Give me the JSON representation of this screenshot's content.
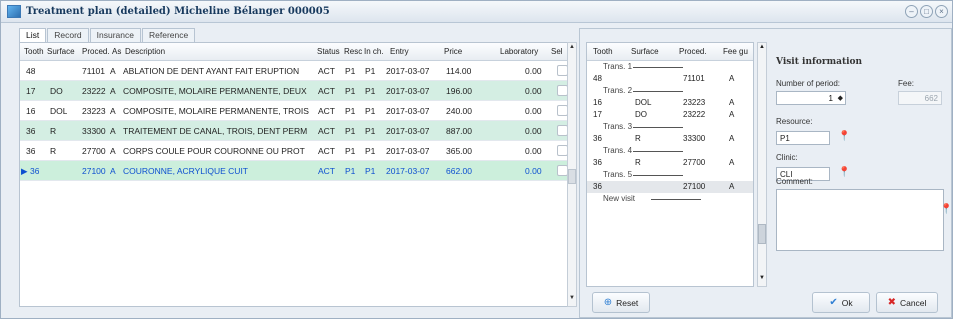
{
  "window": {
    "title": "Treatment plan (detailed) Micheline Bélanger 000005"
  },
  "tabs": [
    "List",
    "Record",
    "Insurance",
    "Reference"
  ],
  "grid": {
    "columns": [
      "Tooth",
      "Surface",
      "Proced.",
      "As",
      "Description",
      "Status",
      "Resc",
      "In ch.",
      "Entry",
      "Price",
      "Laboratory",
      "Sel"
    ],
    "rows": [
      {
        "tooth": "48",
        "surface": "",
        "proced": "71101",
        "as": "A",
        "description": "ABLATION DE DENT AYANT FAIT ERUPTION",
        "status": "ACT",
        "resc": "P1",
        "inch": "P1",
        "entry": "2017-03-07",
        "price": "114.00",
        "lab": "0.00"
      },
      {
        "tooth": "17",
        "surface": "DO",
        "proced": "23222",
        "as": "A",
        "description": "COMPOSITE, MOLAIRE PERMANENTE, DEUX",
        "status": "ACT",
        "resc": "P1",
        "inch": "P1",
        "entry": "2017-03-07",
        "price": "196.00",
        "lab": "0.00"
      },
      {
        "tooth": "16",
        "surface": "DOL",
        "proced": "23223",
        "as": "A",
        "description": "COMPOSITE, MOLAIRE PERMANENTE, TROIS",
        "status": "ACT",
        "resc": "P1",
        "inch": "P1",
        "entry": "2017-03-07",
        "price": "240.00",
        "lab": "0.00"
      },
      {
        "tooth": "36",
        "surface": "R",
        "proced": "33300",
        "as": "A",
        "description": "TRAITEMENT DE CANAL, TROIS, DENT PERM",
        "status": "ACT",
        "resc": "P1",
        "inch": "P1",
        "entry": "2017-03-07",
        "price": "887.00",
        "lab": "0.00"
      },
      {
        "tooth": "36",
        "surface": "R",
        "proced": "27700",
        "as": "A",
        "description": "CORPS COULE POUR COURONNE OU PROT",
        "status": "ACT",
        "resc": "P1",
        "inch": "P1",
        "entry": "2017-03-07",
        "price": "365.00",
        "lab": "0.00"
      },
      {
        "tooth": "36",
        "surface": "",
        "proced": "27100",
        "as": "A",
        "description": "COURONNE, ACRYLIQUE CUIT",
        "status": "ACT",
        "resc": "P1",
        "inch": "P1",
        "entry": "2017-03-07",
        "price": "662.00",
        "lab": "0.00"
      }
    ]
  },
  "trans_list": {
    "columns": [
      "Tooth",
      "Surface",
      "Proced.",
      "Fee gu"
    ],
    "groups": [
      {
        "label": "Trans. 1",
        "rows": [
          {
            "tooth": "48",
            "surface": "",
            "proced": "71101",
            "as": "A"
          }
        ]
      },
      {
        "label": "Trans. 2",
        "rows": [
          {
            "tooth": "16",
            "surface": "DOL",
            "proced": "23223",
            "as": "A"
          },
          {
            "tooth": "17",
            "surface": "DO",
            "proced": "23222",
            "as": "A"
          }
        ]
      },
      {
        "label": "Trans. 3",
        "rows": [
          {
            "tooth": "36",
            "surface": "R",
            "proced": "33300",
            "as": "A"
          }
        ]
      },
      {
        "label": "Trans. 4",
        "rows": [
          {
            "tooth": "36",
            "surface": "R",
            "proced": "27700",
            "as": "A"
          }
        ]
      },
      {
        "label": "Trans. 5",
        "rows": [
          {
            "tooth": "36",
            "surface": "",
            "proced": "27100",
            "as": "A"
          }
        ]
      }
    ],
    "new_visit": "New visit"
  },
  "visit": {
    "heading": "Visit information",
    "period_label": "Number of period:",
    "period_value": "1",
    "fee_label": "Fee:",
    "fee_value": "662",
    "resource_label": "Resource:",
    "resource_value": "P1",
    "clinic_label": "Clinic:",
    "clinic_value": "CLI",
    "comment_label": "Comment:"
  },
  "buttons": {
    "reset": "Reset",
    "ok": "Ok",
    "cancel": "Cancel"
  },
  "colors": {
    "row_green": "#d4eee3",
    "selected_text": "#0d4fd0",
    "pin": "#2b8ce0"
  }
}
